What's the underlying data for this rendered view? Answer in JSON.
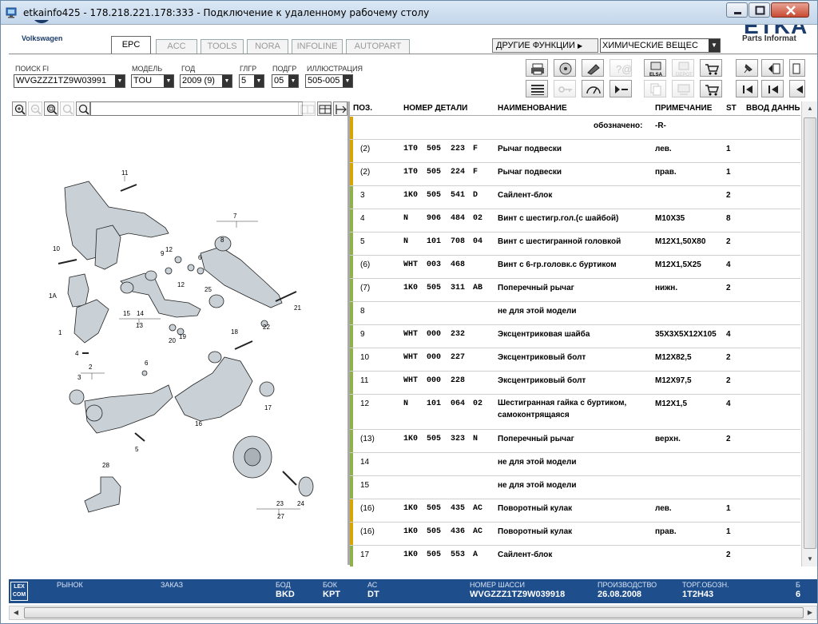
{
  "window": {
    "title": "etkainfo425 - 178.218.221.178:333 - Подключение к удаленному рабочему столу"
  },
  "header": {
    "brand": "Volkswagen",
    "etka_logo": "ETKA",
    "etka_sub": "Parts Informat",
    "tabs": [
      "EPC",
      "ACC",
      "TOOLS",
      "NORA",
      "INFOLINE",
      "AUTOPART"
    ],
    "active_tab": "EPC",
    "other_functions": "ДРУГИЕ ФУНКЦИИ",
    "chemicals": "ХИМИЧЕСКИЕ ВЕЩЕС"
  },
  "filters": {
    "fi_label": "ПОИСК FI",
    "fi_value": "WVGZZZ1TZ9W03991",
    "model_label": "МОДЕЛЬ",
    "model_value": "TOU",
    "year_label": "ГОД",
    "year_value": "2009 (9)",
    "mg_label": "ГЛГР",
    "mg_value": "5",
    "sg_label": "ПОДГР",
    "sg_value": "05",
    "ill_label": "ИЛЛЮСТРАЦИЯ",
    "ill_value": "505-005"
  },
  "toolbar_icons": [
    "print-icon",
    "audio-icon",
    "parts-icon",
    "help-icon",
    "elsa-icon",
    "cart-icon",
    "pin-icon",
    "prev-page-icon",
    "list-icon",
    "key-icon",
    "scale-icon",
    "next-minus-icon",
    "depot-icon",
    "cart-add-icon",
    "first-icon",
    "back-icon"
  ],
  "toolbar_labels": {
    "elsa": "ELSA",
    "depot": "DEPOT"
  },
  "table": {
    "headers": {
      "pos": "ПОЗ.",
      "partno": "НОМЕР ДЕТАЛИ",
      "name": "НАИМЕНОВАНИЕ",
      "note": "ПРИМЕЧАНИЕ",
      "st": "ST",
      "input": "ВВОД ДАННЫХ"
    },
    "rows": [
      {
        "pos": "",
        "p1": "",
        "p2": "",
        "p3": "",
        "p4": "",
        "name": "обозначено:",
        "note": "-R-",
        "qty": "",
        "color": "#d8a400"
      },
      {
        "pos": "(2)",
        "p1": "1T0",
        "p2": "505",
        "p3": "223",
        "p4": "F",
        "name": "Рычаг подвески",
        "note": "лев.",
        "qty": "1",
        "color": "#d8a400"
      },
      {
        "pos": "(2)",
        "p1": "1T0",
        "p2": "505",
        "p3": "224",
        "p4": "F",
        "name": "Рычаг подвески",
        "note": "прав.",
        "qty": "1",
        "color": "#d8a400"
      },
      {
        "pos": "3",
        "p1": "1K0",
        "p2": "505",
        "p3": "541",
        "p4": "D",
        "name": "Сайлент-блок",
        "note": "",
        "qty": "2",
        "color": "#8fb04a"
      },
      {
        "pos": "4",
        "p1": "N",
        "p2": "906",
        "p3": "484",
        "p4": "02",
        "name": "Винт с шестигр.гол.(с шайбой)",
        "note": "M10X35",
        "qty": "8",
        "color": "#8fb04a"
      },
      {
        "pos": "5",
        "p1": "N",
        "p2": "101",
        "p3": "708",
        "p4": "04",
        "name": "Винт с шестигранной головкой",
        "note": "M12X1,50X80",
        "qty": "2",
        "color": "#8fb04a"
      },
      {
        "pos": "(6)",
        "p1": "WHT",
        "p2": "003",
        "p3": "468",
        "p4": "",
        "name": "Винт с 6-гр.головк.с буртиком",
        "note": "M12X1,5X25",
        "qty": "4",
        "color": "#8fb04a"
      },
      {
        "pos": "(7)",
        "p1": "1K0",
        "p2": "505",
        "p3": "311",
        "p4": "AB",
        "name": "Поперечный рычаг",
        "note": "нижн.",
        "qty": "2",
        "color": "#8fb04a"
      },
      {
        "pos": "8",
        "p1": "",
        "p2": "",
        "p3": "",
        "p4": "",
        "name": "не для этой модели",
        "note": "",
        "qty": "",
        "color": "#8fb04a"
      },
      {
        "pos": "9",
        "p1": "WHT",
        "p2": "000",
        "p3": "232",
        "p4": "",
        "name": "Эксцентриковая шайба",
        "note": "35X3X5X12X105",
        "qty": "4",
        "color": "#8fb04a"
      },
      {
        "pos": "10",
        "p1": "WHT",
        "p2": "000",
        "p3": "227",
        "p4": "",
        "name": "Эксцентриковый болт",
        "note": "M12X82,5",
        "qty": "2",
        "color": "#8fb04a"
      },
      {
        "pos": "11",
        "p1": "WHT",
        "p2": "000",
        "p3": "228",
        "p4": "",
        "name": "Эксцентриковый болт",
        "note": "M12X97,5",
        "qty": "2",
        "color": "#8fb04a"
      },
      {
        "pos": "12",
        "p1": "N",
        "p2": "101",
        "p3": "064",
        "p4": "02",
        "name": "Шестигранная гайка с буртиком, самоконтрящаяся",
        "note": "M12X1,5",
        "qty": "4",
        "color": "#8fb04a"
      },
      {
        "pos": "(13)",
        "p1": "1K0",
        "p2": "505",
        "p3": "323",
        "p4": "N",
        "name": "Поперечный рычаг",
        "note": "верхн.",
        "qty": "2",
        "color": "#8fb04a"
      },
      {
        "pos": "14",
        "p1": "",
        "p2": "",
        "p3": "",
        "p4": "",
        "name": "не для этой модели",
        "note": "",
        "qty": "",
        "color": "#8fb04a"
      },
      {
        "pos": "15",
        "p1": "",
        "p2": "",
        "p3": "",
        "p4": "",
        "name": "не для этой модели",
        "note": "",
        "qty": "",
        "color": "#8fb04a"
      },
      {
        "pos": "(16)",
        "p1": "1K0",
        "p2": "505",
        "p3": "435",
        "p4": "AC",
        "name": "Поворотный кулак",
        "note": "лев.",
        "qty": "1",
        "color": "#d8a400"
      },
      {
        "pos": "(16)",
        "p1": "1K0",
        "p2": "505",
        "p3": "436",
        "p4": "AC",
        "name": "Поворотный кулак",
        "note": "прав.",
        "qty": "1",
        "color": "#d8a400"
      },
      {
        "pos": "17",
        "p1": "1K0",
        "p2": "505",
        "p3": "553",
        "p4": "A",
        "name": "Сайлент-блок",
        "note": "",
        "qty": "2",
        "color": "#8fb04a"
      }
    ]
  },
  "illustration_labels": [
    "11",
    "7",
    "10",
    "12",
    "9",
    "6",
    "12",
    "25",
    "1A",
    "15",
    "14",
    "13",
    "21",
    "1",
    "20",
    "19",
    "22",
    "4",
    "18",
    "2",
    "3",
    "6",
    "16",
    "17",
    "5",
    "28",
    "23",
    "24",
    "27",
    "8"
  ],
  "status": {
    "lexcom": "LEX COM",
    "market_label": "РЫНОК",
    "market_value": "",
    "order_label": "ЗАКАЗ",
    "order_value": "",
    "bod_label": "БОД",
    "bod_value": "BKD",
    "bok_label": "БОК",
    "bok_value": "KPT",
    "ac_label": "АС",
    "ac_value": "DT",
    "vin_label": "НОМЕР ШАССИ",
    "vin_value": "WVGZZZ1TZ9W039918",
    "prod_label": "ПРОИЗВОДСТВО",
    "prod_value": "26.08.2008",
    "trade_label": "ТОРГ.ОБОЗН.",
    "trade_value": "1T2H43",
    "extra_label": "Б",
    "extra_value": "6"
  }
}
